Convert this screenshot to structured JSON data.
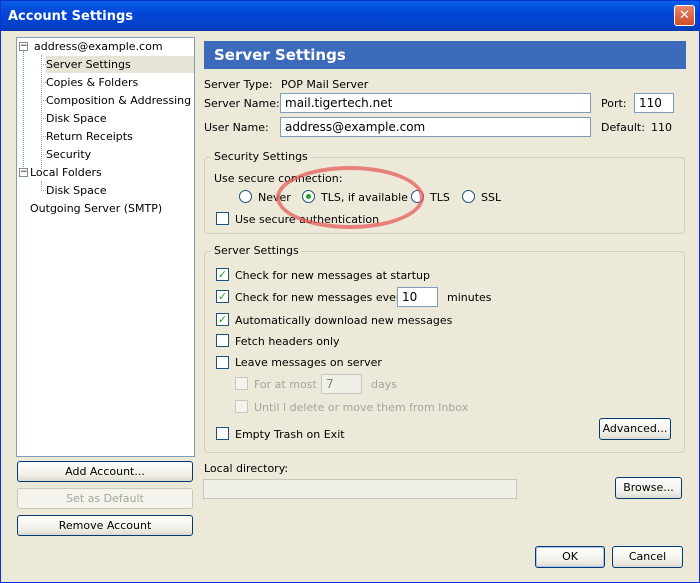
{
  "window": {
    "title": "Account Settings",
    "close_glyph": "✕"
  },
  "tree": {
    "items": [
      {
        "label": "address@example.com"
      },
      {
        "label": "Server Settings"
      },
      {
        "label": "Copies & Folders"
      },
      {
        "label": "Composition & Addressing"
      },
      {
        "label": "Disk Space"
      },
      {
        "label": "Return Receipts"
      },
      {
        "label": "Security"
      },
      {
        "label": "Local Folders"
      },
      {
        "label": "Disk Space"
      },
      {
        "label": "Outgoing Server (SMTP)"
      }
    ],
    "expander_glyph": "−"
  },
  "left_buttons": {
    "add_account": "Add Account...",
    "set_default": "Set as Default",
    "remove_account": "Remove Account"
  },
  "panel": {
    "header": "Server Settings",
    "server_type_label": "Server Type:",
    "server_type_value": "POP Mail Server",
    "server_name_label": "Server Name:",
    "server_name_value": "mail.tigertech.net",
    "port_label": "Port:",
    "port_value": "110",
    "user_name_label": "User Name:",
    "user_name_value": "address@example.com",
    "default_label": "Default:",
    "default_value": "110"
  },
  "security": {
    "legend": "Security Settings",
    "use_secure_label": "Use secure connection:",
    "options": [
      {
        "label": "Never"
      },
      {
        "label": "TLS, if available"
      },
      {
        "label": "TLS"
      },
      {
        "label": "SSL"
      }
    ],
    "selected": "TLS, if available",
    "secure_auth_label": "Use secure authentication"
  },
  "server_settings": {
    "legend": "Server Settings",
    "check_startup": "Check for new messages at startup",
    "check_every": "Check for new messages every",
    "check_every_value": "10",
    "minutes": "minutes",
    "auto_download": "Automatically download new messages",
    "fetch_headers": "Fetch headers only",
    "leave_on_server": "Leave messages on server",
    "for_at_most": "For at most",
    "for_at_most_value": "7",
    "days": "days",
    "until_delete": "Until I delete or move them from Inbox",
    "empty_trash": "Empty Trash on Exit",
    "advanced": "Advanced...",
    "check_glyph": "✓"
  },
  "local_directory": {
    "label": "Local directory:",
    "value": "",
    "browse": "Browse..."
  },
  "footer": {
    "ok": "OK",
    "cancel": "Cancel"
  },
  "colors": {
    "header_bg": "#3d6bbc",
    "titlebar": "#0146d8",
    "highlight_ellipse": "#e55c5c",
    "check": "#21a121"
  }
}
